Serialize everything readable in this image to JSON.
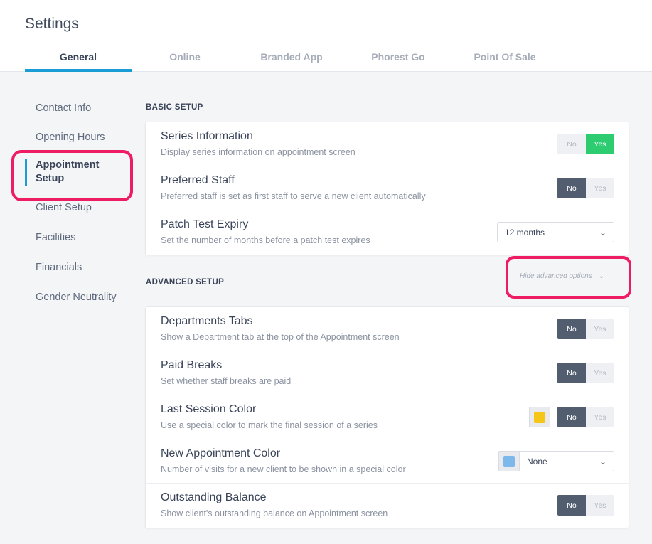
{
  "page": {
    "title": "Settings"
  },
  "tabs": [
    {
      "label": "General"
    },
    {
      "label": "Online"
    },
    {
      "label": "Branded App"
    },
    {
      "label": "Phorest Go"
    },
    {
      "label": "Point Of Sale"
    }
  ],
  "sidebar": {
    "items": [
      {
        "label": "Contact Info"
      },
      {
        "label": "Opening Hours"
      },
      {
        "label": "Appointment Setup"
      },
      {
        "label": "Client Setup"
      },
      {
        "label": "Facilities"
      },
      {
        "label": "Financials"
      },
      {
        "label": "Gender Neutrality"
      }
    ]
  },
  "basic": {
    "heading": "BASIC SETUP",
    "rows": [
      {
        "title": "Series Information",
        "desc": "Display series information on appointment screen",
        "no": "No",
        "yes": "Yes",
        "value": "Yes"
      },
      {
        "title": "Preferred Staff",
        "desc": "Preferred staff is set as first staff to serve a new client automatically",
        "no": "No",
        "yes": "Yes",
        "value": "No"
      },
      {
        "title": "Patch Test Expiry",
        "desc": "Set the number of months before a patch test expires",
        "select_value": "12 months"
      }
    ]
  },
  "advanced": {
    "heading": "ADVANCED SETUP",
    "toggle_label": "Hide advanced options",
    "rows": [
      {
        "title": "Departments Tabs",
        "desc": "Show a Department tab at the top of the Appointment screen",
        "no": "No",
        "yes": "Yes",
        "value": "No"
      },
      {
        "title": "Paid Breaks",
        "desc": "Set whether staff breaks are paid",
        "no": "No",
        "yes": "Yes",
        "value": "No"
      },
      {
        "title": "Last Session Color",
        "desc": "Use a special color to mark the final session of a series",
        "no": "No",
        "yes": "Yes",
        "value": "No",
        "color": "#f5c518"
      },
      {
        "title": "New Appointment Color",
        "desc": "Number of visits for a new client to be shown in a special color",
        "select_value": "None",
        "color": "#7cb9ea"
      },
      {
        "title": "Outstanding Balance",
        "desc": "Show client's outstanding balance on Appointment screen",
        "no": "No",
        "yes": "Yes",
        "value": "No"
      }
    ]
  },
  "colors": {
    "accent": "#1a9dd4",
    "highlight": "#ee1c63",
    "yes_on": "#2ecc71",
    "no_on": "#525d70"
  }
}
